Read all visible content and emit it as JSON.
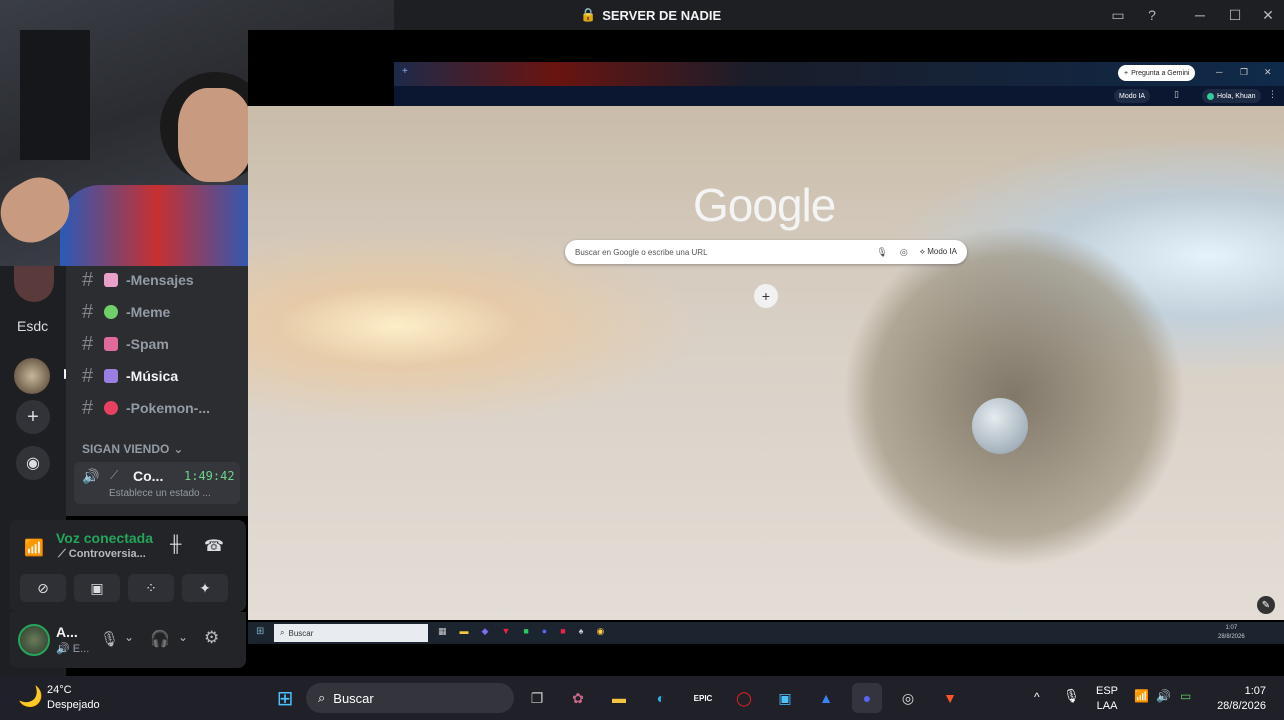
{
  "titlebar": {
    "server_name": "SERVER DE NADIE"
  },
  "rail": {
    "server_abbrev": "Esdc"
  },
  "channels": [
    {
      "label": "-Mensajes",
      "color": "#e8a0c8"
    },
    {
      "label": "-Meme",
      "color": "#6fcf6a"
    },
    {
      "label": "-Spam",
      "color": "#e06a9a"
    },
    {
      "label": "-Música",
      "color": "#9b7fe0"
    },
    {
      "label": "-Pokemon-...",
      "color": "#e84060"
    }
  ],
  "voice_category": "SIGAN VIENDO",
  "voice_channel": {
    "name": "Co...",
    "duration": "1:49:42",
    "status": "Establece un estado ..."
  },
  "voice_panel": {
    "status": "Voz conectada",
    "channel": "Controversia..."
  },
  "user": {
    "name": "A...",
    "sub": "E..."
  },
  "browser": {
    "gemini_btn": "Pregunta a Gemini",
    "mode_ia": "Modo IA",
    "greeting": "Hola, Khuan",
    "google_logo": "Google",
    "search_placeholder": "Buscar en Google o escribe una URL",
    "search_mode": "Modo IA"
  },
  "inner_taskbar": {
    "search": "Buscar",
    "time": "1:07",
    "date": "28/8/2026"
  },
  "taskbar": {
    "temp": "24°C",
    "weather": "Despejado",
    "search": "Buscar",
    "lang1": "ESP",
    "lang2": "LAA",
    "time": "1:07",
    "date": "28/8/2026"
  },
  "colors": {
    "discord_dark": "#1e1f22",
    "discord_sidebar": "#2b2d31",
    "voice_green": "#23a55a",
    "taskbar": "#202028"
  }
}
